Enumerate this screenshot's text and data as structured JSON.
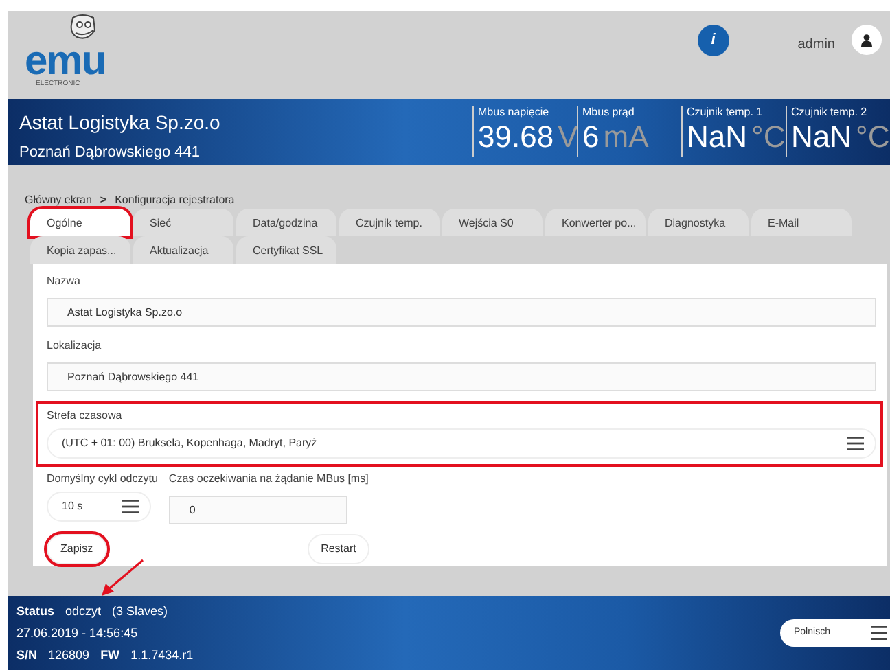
{
  "header": {
    "logo": {
      "text": "emu",
      "subtext": "ELECTRONIC"
    },
    "info_button": "i",
    "user": "admin"
  },
  "device": {
    "name": "Astat Logistyka Sp.zo.o",
    "location": "Poznań Dąbrowskiego 441",
    "readings": [
      {
        "label": "Mbus napięcie",
        "value": "39.68",
        "unit": "V"
      },
      {
        "label": "Mbus prąd",
        "value": "6",
        "unit": "mA"
      },
      {
        "label": "Czujnik temp. 1",
        "value": "NaN",
        "unit": "°C"
      },
      {
        "label": "Czujnik temp. 2",
        "value": "NaN",
        "unit": "°C"
      }
    ]
  },
  "breadcrumb": {
    "items": [
      "Główny ekran",
      "Konfiguracja rejestratora"
    ],
    "separator": ">"
  },
  "tabs": [
    {
      "label": "Ogólne",
      "selected": true,
      "highlighted": true
    },
    {
      "label": "Sieć",
      "selected": false,
      "highlighted": false
    },
    {
      "label": "Data/godzina",
      "selected": false,
      "highlighted": false
    },
    {
      "label": "Czujnik temp.",
      "selected": false,
      "highlighted": false
    },
    {
      "label": "Wejścia S0",
      "selected": false,
      "highlighted": false
    },
    {
      "label": "Konwerter po...",
      "selected": false,
      "highlighted": false
    },
    {
      "label": "Diagnostyka",
      "selected": false,
      "highlighted": false
    },
    {
      "label": "E-Mail",
      "selected": false,
      "highlighted": false
    },
    {
      "label": "Kopia zapas...",
      "selected": false,
      "highlighted": false
    },
    {
      "label": "Aktualizacja",
      "selected": false,
      "highlighted": false
    },
    {
      "label": "Certyfikat SSL",
      "selected": false,
      "highlighted": false
    }
  ],
  "form": {
    "fields": [
      {
        "kind": "text",
        "label": "Nazwa",
        "value": "Astat Logistyka Sp.zo.o",
        "highlighted": false
      },
      {
        "kind": "text",
        "label": "Lokalizacja",
        "value": "Poznań Dąbrowskiego 441",
        "highlighted": false
      },
      {
        "kind": "select",
        "label": "Strefa czasowa",
        "value": "(UTC + 01: 00) Bruksela, Kopenhaga, Madryt, Paryż",
        "highlighted": true
      }
    ],
    "inline_fields": [
      {
        "kind": "select",
        "label": "Domyślny cykl odczytu",
        "value": "10 s"
      },
      {
        "kind": "text",
        "label": "Czas oczekiwania na żądanie MBus [ms]",
        "value": "0"
      }
    ],
    "buttons": [
      {
        "label": "Zapisz",
        "highlighted": true
      },
      {
        "label": "Restart",
        "highlighted": false
      }
    ]
  },
  "annotations": [
    {
      "kind": "arrow"
    }
  ],
  "status_bar": {
    "status_label": "Status",
    "status": "odczyt",
    "slaves": "(3 Slaves)",
    "datetime": "27.06.2019 - 14:56:45",
    "sn_label": "S/N",
    "sn": "126809",
    "fw_label": "FW",
    "fw": "1.1.7434.r1",
    "language": "Polnisch"
  }
}
